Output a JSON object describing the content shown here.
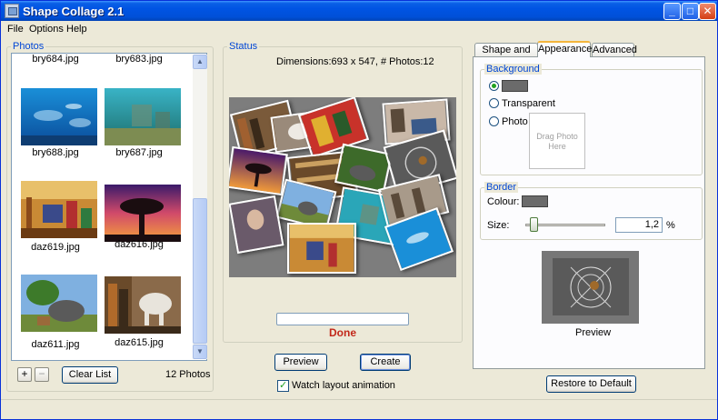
{
  "window": {
    "title": "Shape Collage 2.1",
    "minimize_glyph": "_",
    "maximize_glyph": "□",
    "close_glyph": "✕"
  },
  "menu": [
    "File",
    "Options",
    "Help"
  ],
  "photos": {
    "legend": "Photos",
    "items": [
      {
        "name": "bry684.jpg",
        "icon": "underwater-thumbnail"
      },
      {
        "name": "bry683.jpg",
        "icon": "underwater-thumbnail"
      },
      {
        "name": "bry688.jpg",
        "icon": "underwater-dolphins-thumbnail"
      },
      {
        "name": "bry687.jpg",
        "icon": "underwater-ruins-thumbnail"
      },
      {
        "name": "daz619.jpg",
        "icon": "toy-room-thumbnail"
      },
      {
        "name": "daz616.jpg",
        "icon": "sunset-tree-thumbnail"
      },
      {
        "name": "daz611.jpg",
        "icon": "rhino-thumbnail"
      },
      {
        "name": "daz615.jpg",
        "icon": "elephant-thumbnail"
      }
    ],
    "add_label": "+",
    "remove_label": "−",
    "clear_label": "Clear List",
    "count_label": "12 Photos"
  },
  "status": {
    "legend": "Status",
    "dimensions_text": "Dimensions:693 x 547, # Photos:12",
    "progress_fraction": 0,
    "done_text": "Done",
    "preview_button": "Preview",
    "create_button": "Create",
    "watch_label": "Watch layout animation",
    "watch_checked": true
  },
  "tabs": [
    "Shape and Size",
    "Appearance",
    "Advanced"
  ],
  "active_tab": "Appearance",
  "appearance": {
    "background_legend": "Background",
    "background_color": "#6b6b6b",
    "transparent_label": "Transparent",
    "photo_label": "Photo",
    "drop_text_line1": "Drag Photo",
    "drop_text_line2": "Here",
    "border_legend": "Border",
    "colour_label": "Colour:",
    "border_color": "#6b6b6b",
    "size_label": "Size:",
    "size_value": "1,2",
    "size_unit": "%",
    "preview_label": "Preview",
    "restore_button": "Restore to Default"
  },
  "colors": {
    "accent_blue": "#0046d5",
    "done_red": "#c2281a",
    "check_green": "#21a121"
  }
}
